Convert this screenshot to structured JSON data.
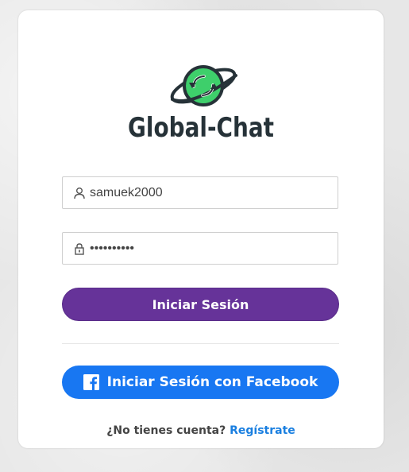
{
  "brand": {
    "name": "Global-Chat",
    "logo_icon": "globe-sync-icon"
  },
  "form": {
    "username": {
      "icon": "user-icon",
      "value": "samuek2000"
    },
    "password": {
      "icon": "lock-icon",
      "value": "••••••••••"
    },
    "login_label": "Iniciar Sesión",
    "facebook": {
      "icon": "facebook-icon",
      "label": "Iniciar Sesión con Facebook"
    }
  },
  "signup": {
    "prompt": "¿No tienes cuenta?",
    "link_label": "Regístrate"
  },
  "colors": {
    "primary": "#663399",
    "facebook": "#1877f2",
    "link": "#1a7fe0",
    "logo_green": "#3ecf6b",
    "text_dark": "#263238"
  }
}
